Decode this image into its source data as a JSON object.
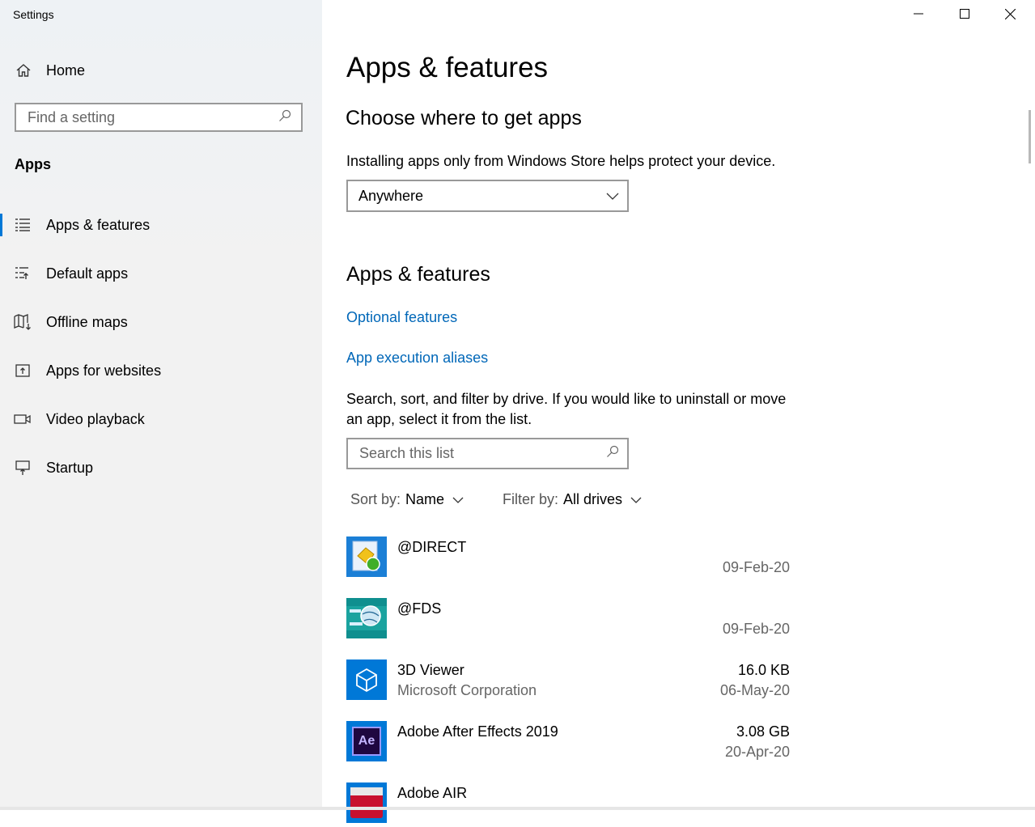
{
  "window": {
    "title": "Settings"
  },
  "sidebar": {
    "home_label": "Home",
    "search_placeholder": "Find a setting",
    "section_title": "Apps",
    "items": [
      {
        "label": "Apps & features",
        "icon": "apps-features-icon",
        "active": true
      },
      {
        "label": "Default apps",
        "icon": "default-apps-icon",
        "active": false
      },
      {
        "label": "Offline maps",
        "icon": "offline-maps-icon",
        "active": false
      },
      {
        "label": "Apps for websites",
        "icon": "apps-for-websites-icon",
        "active": false
      },
      {
        "label": "Video playback",
        "icon": "video-playback-icon",
        "active": false
      },
      {
        "label": "Startup",
        "icon": "startup-icon",
        "active": false
      }
    ]
  },
  "main": {
    "title": "Apps & features",
    "choose_heading": "Choose where to get apps",
    "choose_desc": "Installing apps only from Windows Store helps protect your device.",
    "source_selected": "Anywhere",
    "features_heading": "Apps & features",
    "links": {
      "optional_features": "Optional features",
      "execution_aliases": "App execution aliases"
    },
    "list_desc": "Search, sort, and filter by drive. If you would like to uninstall or move an app, select it from the list.",
    "search_placeholder": "Search this list",
    "sort": {
      "label": "Sort by:",
      "value": "Name"
    },
    "filter": {
      "label": "Filter by:",
      "value": "All drives"
    },
    "apps": [
      {
        "name": "@DIRECT",
        "publisher": "",
        "size": "",
        "date": "09-Feb-20"
      },
      {
        "name": "@FDS",
        "publisher": "",
        "size": "",
        "date": "09-Feb-20"
      },
      {
        "name": "3D Viewer",
        "publisher": "Microsoft Corporation",
        "size": "16.0 KB",
        "date": "06-May-20"
      },
      {
        "name": "Adobe After Effects 2019",
        "publisher": "",
        "size": "3.08 GB",
        "date": "20-Apr-20"
      },
      {
        "name": "Adobe AIR",
        "publisher": "",
        "size": "",
        "date": ""
      }
    ],
    "ae_icon_text": "Ae"
  },
  "colors": {
    "accent": "#0078d7",
    "link": "#0067b8",
    "sidebar_bg": "#f2f2f2"
  }
}
